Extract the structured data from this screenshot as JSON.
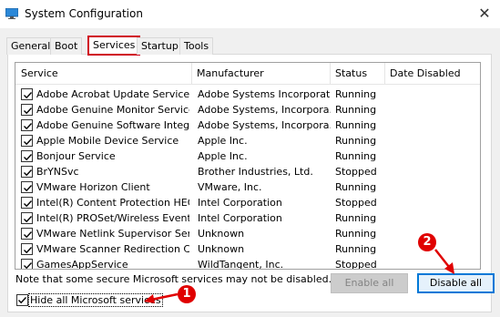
{
  "window": {
    "title": "System Configuration",
    "close_glyph": "✕"
  },
  "tabs": [
    {
      "label": "General",
      "active": false
    },
    {
      "label": "Boot",
      "active": false
    },
    {
      "label": "Services",
      "active": true
    },
    {
      "label": "Startup",
      "active": false
    },
    {
      "label": "Tools",
      "active": false
    }
  ],
  "table": {
    "columns": [
      "Service",
      "Manufacturer",
      "Status",
      "Date Disabled"
    ],
    "rows": [
      {
        "service": "Adobe Acrobat Update Service",
        "manufacturer": "Adobe Systems Incorporated",
        "status": "Running",
        "checked": true
      },
      {
        "service": "Adobe Genuine Monitor Service",
        "manufacturer": "Adobe Systems, Incorpora...",
        "status": "Running",
        "checked": true
      },
      {
        "service": "Adobe Genuine Software Integri...",
        "manufacturer": "Adobe Systems, Incorpora...",
        "status": "Running",
        "checked": true
      },
      {
        "service": "Apple Mobile Device Service",
        "manufacturer": "Apple Inc.",
        "status": "Running",
        "checked": true
      },
      {
        "service": "Bonjour Service",
        "manufacturer": "Apple Inc.",
        "status": "Running",
        "checked": true
      },
      {
        "service": "BrYNSvc",
        "manufacturer": "Brother Industries, Ltd.",
        "status": "Stopped",
        "checked": true
      },
      {
        "service": "VMware Horizon Client",
        "manufacturer": "VMware, Inc.",
        "status": "Running",
        "checked": true
      },
      {
        "service": "Intel(R) Content Protection HEC...",
        "manufacturer": "Intel Corporation",
        "status": "Stopped",
        "checked": true
      },
      {
        "service": "Intel(R) PROSet/Wireless Event ...",
        "manufacturer": "Intel Corporation",
        "status": "Running",
        "checked": true
      },
      {
        "service": "VMware Netlink Supervisor Service",
        "manufacturer": "Unknown",
        "status": "Running",
        "checked": true
      },
      {
        "service": "VMware Scanner Redirection Client",
        "manufacturer": "Unknown",
        "status": "Running",
        "checked": true
      },
      {
        "service": "GamesAppService",
        "manufacturer": "WildTangent, Inc.",
        "status": "Stopped",
        "checked": true
      }
    ]
  },
  "note": "Note that some secure Microsoft services may not be disabled.",
  "hide_microsoft": {
    "label": "Hide all Microsoft services",
    "checked": true
  },
  "buttons": {
    "enable_all": "Enable all",
    "disable_all": "Disable all",
    "enable_all_enabled": false
  },
  "annotations": {
    "callout_1": "1",
    "callout_2": "2",
    "accent_color": "#e00000"
  }
}
